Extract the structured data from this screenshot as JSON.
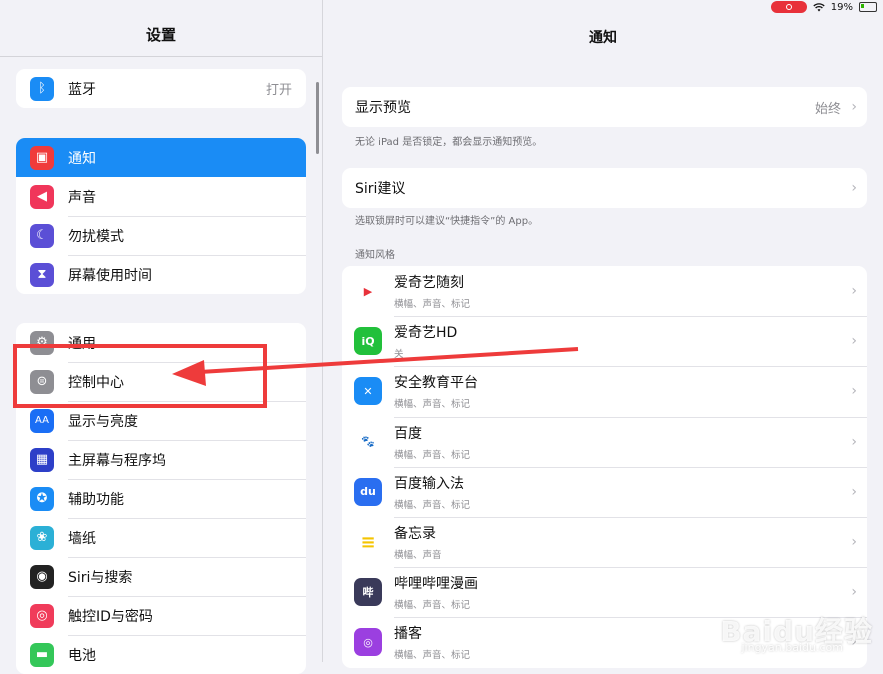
{
  "status": {
    "battery": "19%"
  },
  "left": {
    "title": "设置",
    "group1": [
      {
        "label": "蓝牙",
        "value": "打开",
        "icon": "bluetooth-icon",
        "color": "#1a8cf5"
      }
    ],
    "group2": [
      {
        "label": "通知",
        "icon": "notifications-icon",
        "color": "#f03b3b",
        "selected": true
      },
      {
        "label": "声音",
        "icon": "speaker-icon",
        "color": "#f0365a"
      },
      {
        "label": "勿扰模式",
        "icon": "moon-icon",
        "color": "#5b4fd6"
      },
      {
        "label": "屏幕使用时间",
        "icon": "hourglass-icon",
        "color": "#5b4fd6"
      }
    ],
    "group3": [
      {
        "label": "通用",
        "icon": "gear-icon",
        "color": "#8e8e93"
      },
      {
        "label": "控制中心",
        "icon": "control-center-icon",
        "color": "#8e8e93"
      },
      {
        "label": "显示与亮度",
        "icon": "display-icon",
        "color": "#1a6ef5"
      },
      {
        "label": "主屏幕与程序坞",
        "icon": "home-screen-icon",
        "color": "#2d3fc8"
      },
      {
        "label": "辅助功能",
        "icon": "accessibility-icon",
        "color": "#1a8cf5"
      },
      {
        "label": "墙纸",
        "icon": "wallpaper-icon",
        "color": "#2bb0d6"
      },
      {
        "label": "Siri与搜索",
        "icon": "siri-icon",
        "color": "#222222"
      },
      {
        "label": "触控ID与密码",
        "icon": "fingerprint-icon",
        "color": "#f03b5a"
      },
      {
        "label": "电池",
        "icon": "battery-icon",
        "color": "#34c759"
      }
    ]
  },
  "right": {
    "title": "通知",
    "preview": {
      "label": "显示预览",
      "value": "始终",
      "footer": "无论 iPad 是否锁定，都会显示通知预览。"
    },
    "siri": {
      "label": "Siri建议",
      "footer": "选取锁屏时可以建议“快捷指令”的 App。"
    },
    "style_header": "通知风格",
    "apps": [
      {
        "name": "爱奇艺随刻",
        "sub": "横幅、声音、标记",
        "icon": "iqiyi-suike-icon",
        "color": "#ffffff"
      },
      {
        "name": "爱奇艺HD",
        "sub": "关",
        "icon": "iqiyi-hd-icon",
        "color": "#22c03b"
      },
      {
        "name": "安全教育平台",
        "sub": "横幅、声音、标记",
        "icon": "safety-edu-icon",
        "color": "#1a8cf5"
      },
      {
        "name": "百度",
        "sub": "横幅、声音、标记",
        "icon": "baidu-icon",
        "color": "#ffffff"
      },
      {
        "name": "百度输入法",
        "sub": "横幅、声音、标记",
        "icon": "baidu-input-icon",
        "color": "#2a6ef0"
      },
      {
        "name": "备忘录",
        "sub": "横幅、声音",
        "icon": "notes-icon",
        "color": "#ffffff"
      },
      {
        "name": "哔哩哔哩漫画",
        "sub": "横幅、声音、标记",
        "icon": "bilibili-comic-icon",
        "color": "#3a3a5a"
      },
      {
        "name": "播客",
        "sub": "横幅、声音、标记",
        "icon": "podcasts-icon",
        "color": "#9b3fe0"
      }
    ]
  },
  "watermark": {
    "logo": "Baidu经验",
    "url": "jingyan.baidu.com"
  }
}
